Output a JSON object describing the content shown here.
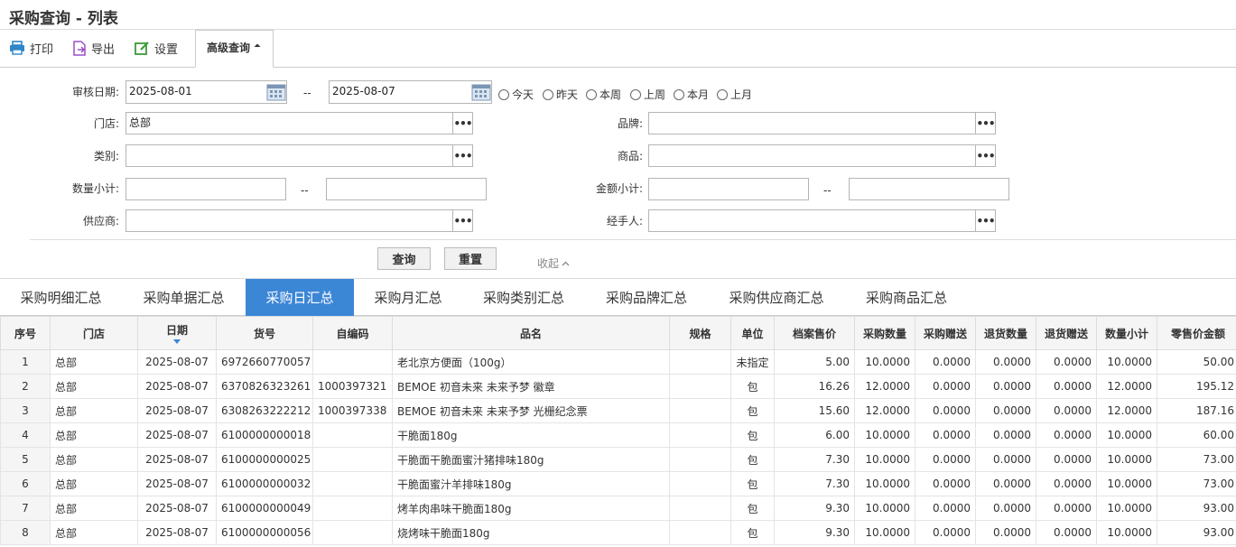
{
  "page_title": "采购查询 - 列表",
  "toolbar": {
    "print": "打印",
    "export": "导出",
    "settings": "设置",
    "advanced": "高级查询"
  },
  "filters": {
    "audit_date_label": "审核日期:",
    "date_from": "2025-08-01",
    "date_sep": "--",
    "date_to": "2025-08-07",
    "quick_dates": [
      "今天",
      "昨天",
      "本周",
      "上周",
      "本月",
      "上月"
    ],
    "store_label": "门店:",
    "store_value": "总部",
    "brand_label": "品牌:",
    "category_label": "类别:",
    "product_label": "商品:",
    "qty_label": "数量小计:",
    "qty_sep": "--",
    "amount_label": "金额小计:",
    "amount_sep": "--",
    "supplier_label": "供应商:",
    "handler_label": "经手人:",
    "query_button": "查询",
    "reset_button": "重置",
    "collapse": "收起"
  },
  "tabs": [
    "采购明细汇总",
    "采购单据汇总",
    "采购日汇总",
    "采购月汇总",
    "采购类别汇总",
    "采购品牌汇总",
    "采购供应商汇总",
    "采购商品汇总"
  ],
  "active_tab": "采购日汇总",
  "colors": {
    "accent": "#3c86d6",
    "header_bg": "#f5f5f5"
  },
  "table": {
    "columns": [
      "序号",
      "门店",
      "日期",
      "货号",
      "自编码",
      "品名",
      "规格",
      "单位",
      "档案售价",
      "采购数量",
      "采购赠送",
      "退货数量",
      "退货赠送",
      "数量小计",
      "零售价金额"
    ],
    "sorted_column": "日期",
    "rows": [
      [
        "1",
        "总部",
        "2025-08-07",
        "6972660770057",
        "",
        "老北京方便面（100g）",
        "",
        "未指定",
        "5.00",
        "10.0000",
        "0.0000",
        "0.0000",
        "0.0000",
        "10.0000",
        "50.00"
      ],
      [
        "2",
        "总部",
        "2025-08-07",
        "6370826323261",
        "1000397321",
        "BEMOE 初音未来 未来予梦 徽章",
        "",
        "包",
        "16.26",
        "12.0000",
        "0.0000",
        "0.0000",
        "0.0000",
        "12.0000",
        "195.12"
      ],
      [
        "3",
        "总部",
        "2025-08-07",
        "6308263222212",
        "1000397338",
        "BEMOE 初音未来 未来予梦 光栅纪念票",
        "",
        "包",
        "15.60",
        "12.0000",
        "0.0000",
        "0.0000",
        "0.0000",
        "12.0000",
        "187.16"
      ],
      [
        "4",
        "总部",
        "2025-08-07",
        "6100000000018",
        "",
        "干脆面180g",
        "",
        "包",
        "6.00",
        "10.0000",
        "0.0000",
        "0.0000",
        "0.0000",
        "10.0000",
        "60.00"
      ],
      [
        "5",
        "总部",
        "2025-08-07",
        "6100000000025",
        "",
        "干脆面干脆面蜜汁猪排味180g",
        "",
        "包",
        "7.30",
        "10.0000",
        "0.0000",
        "0.0000",
        "0.0000",
        "10.0000",
        "73.00"
      ],
      [
        "6",
        "总部",
        "2025-08-07",
        "6100000000032",
        "",
        "干脆面蜜汁羊排味180g",
        "",
        "包",
        "7.30",
        "10.0000",
        "0.0000",
        "0.0000",
        "0.0000",
        "10.0000",
        "73.00"
      ],
      [
        "7",
        "总部",
        "2025-08-07",
        "6100000000049",
        "",
        "烤羊肉串味干脆面180g",
        "",
        "包",
        "9.30",
        "10.0000",
        "0.0000",
        "0.0000",
        "0.0000",
        "10.0000",
        "93.00"
      ],
      [
        "8",
        "总部",
        "2025-08-07",
        "6100000000056",
        "",
        "烧烤味干脆面180g",
        "",
        "包",
        "9.30",
        "10.0000",
        "0.0000",
        "0.0000",
        "0.0000",
        "10.0000",
        "93.00"
      ]
    ]
  }
}
